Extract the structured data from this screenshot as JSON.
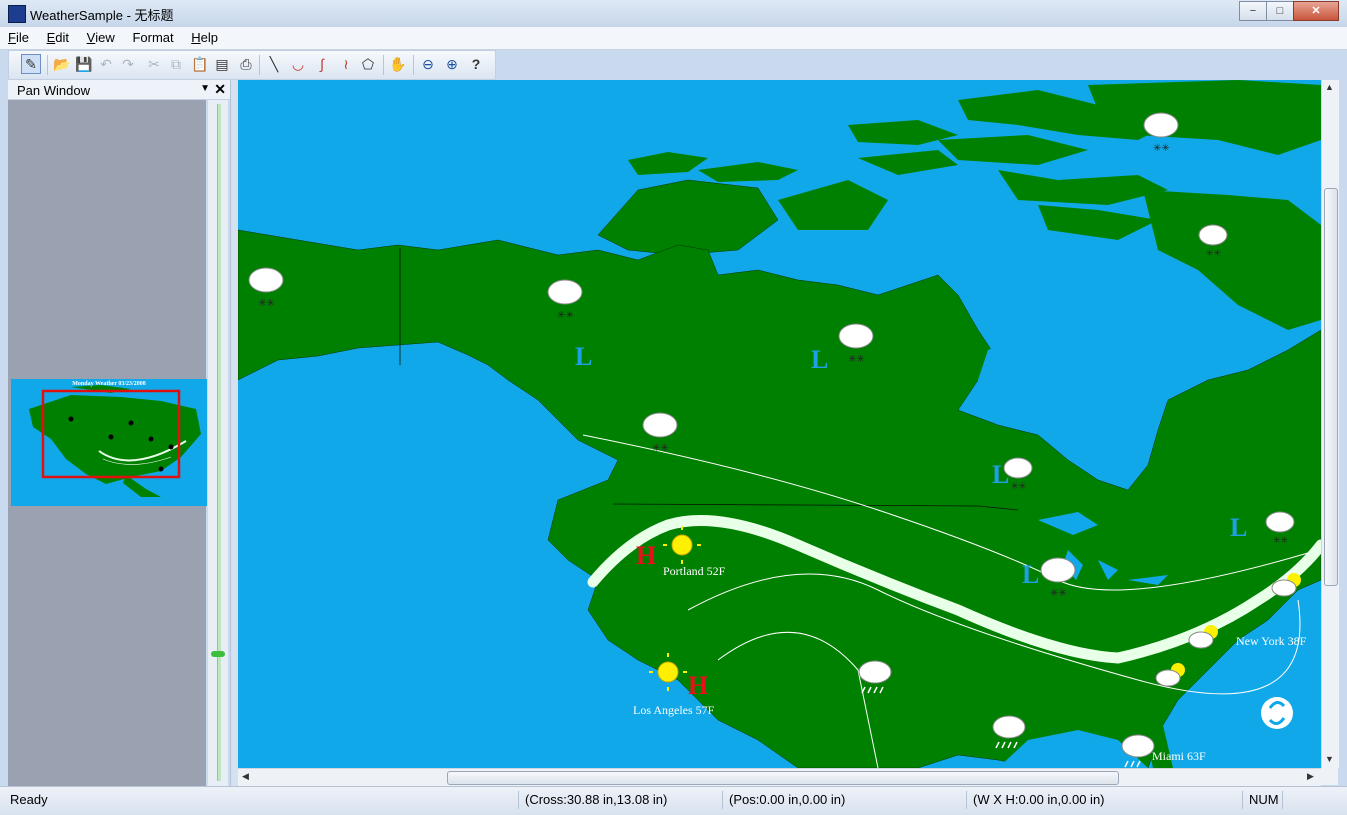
{
  "window": {
    "title": "WeatherSample - 无标题",
    "min": "−",
    "max": "□",
    "close": "✕"
  },
  "menu": {
    "items": [
      {
        "label": "File",
        "accel": "F",
        "rest": "ile"
      },
      {
        "label": "Edit",
        "accel": "E",
        "rest": "dit"
      },
      {
        "label": "View",
        "accel": "V",
        "rest": "iew"
      },
      {
        "label": "Format",
        "accel": "",
        "rest": "Format"
      },
      {
        "label": "Help",
        "accel": "H",
        "rest": "elp"
      }
    ]
  },
  "toolbar": {
    "icons": [
      "select-tool-icon",
      "open-icon",
      "save-icon",
      "undo-icon",
      "redo-icon",
      "cut-icon",
      "copy-icon",
      "paste-icon",
      "paste-special-icon",
      "print-icon",
      "line-tool-icon",
      "warm-front-icon",
      "cold-front-icon",
      "occluded-front-icon",
      "polygon-tool-icon",
      "pan-hand-icon",
      "zoom-out-icon",
      "zoom-in-icon",
      "help-icon"
    ]
  },
  "pan_window": {
    "title": "Pan Window",
    "close": "✕",
    "pin": "▼",
    "mini_title": "Monday Weather 03/23/2008"
  },
  "map": {
    "labels": [
      {
        "text": "Portland 52F"
      },
      {
        "text": "Los Angeles 57F"
      },
      {
        "text": "New York 38F"
      },
      {
        "text": "Miami 63F"
      }
    ],
    "high_symbol": "H",
    "low_symbol": "L",
    "colors": {
      "ocean": "#10a8e8",
      "land": "#008000",
      "high": "#e8101c",
      "low": "#1ea0e6",
      "jet": "#e8ffe8"
    }
  },
  "status": {
    "ready": "Ready",
    "cross": "(Cross:30.88 in,13.08 in)",
    "pos": "(Pos:0.00 in,0.00 in)",
    "wh": "(W X H:0.00 in,0.00 in)",
    "num": "NUM"
  }
}
